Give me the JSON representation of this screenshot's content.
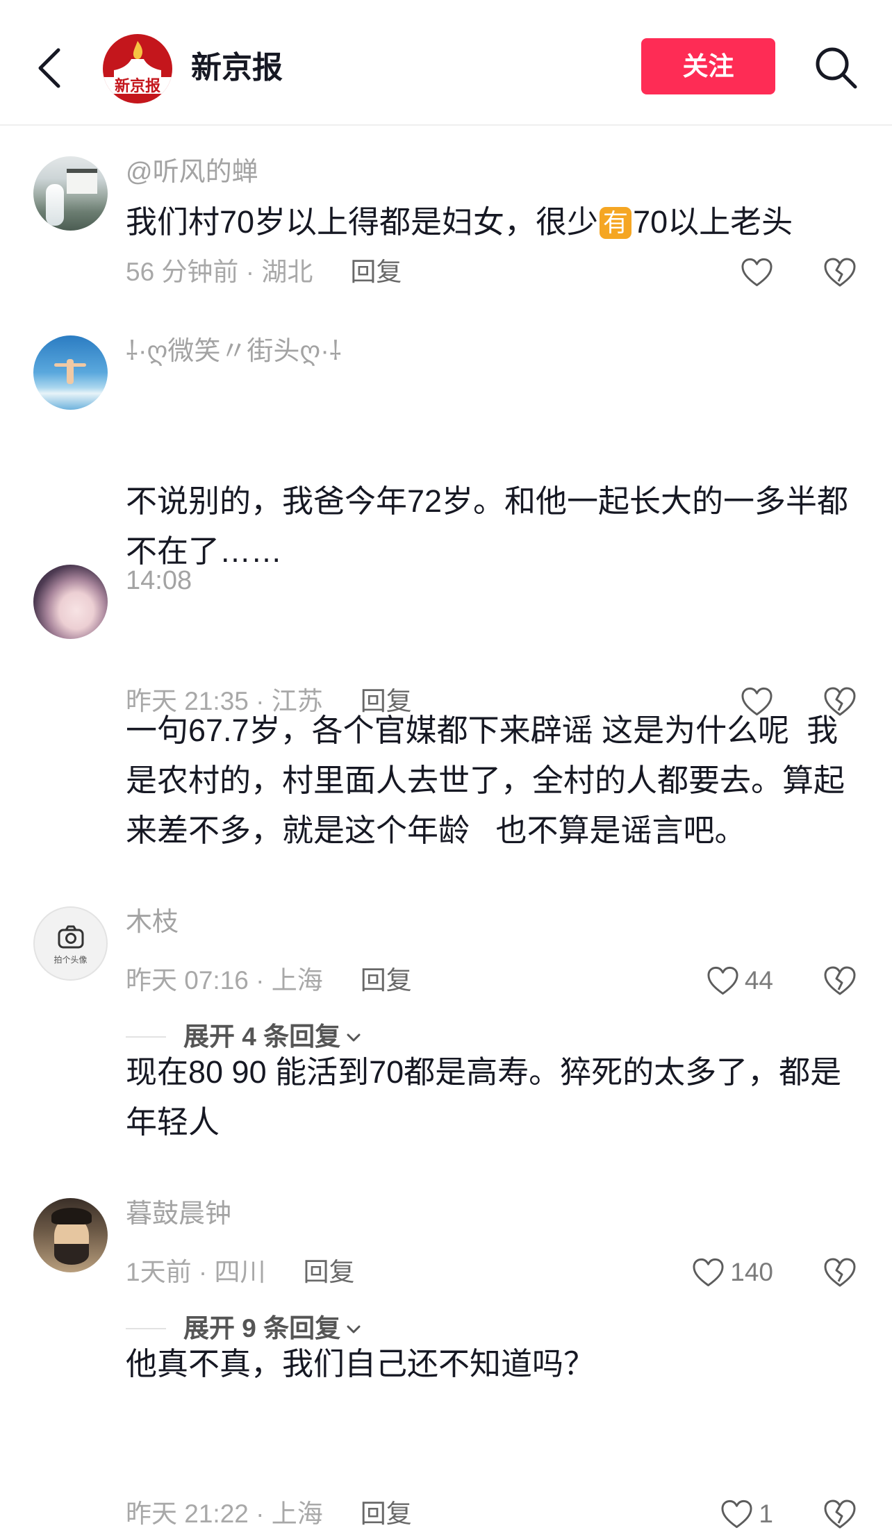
{
  "header": {
    "back_icon": "chevron-left-icon",
    "logo_text": "新京报",
    "title": "新京报",
    "follow_label": "关注",
    "search_icon": "search-icon"
  },
  "colors": {
    "accent": "#FE2C55",
    "text": "#161823",
    "muted": "#A8A8A8",
    "emoji_badge": "#F5A623"
  },
  "icons": {
    "like": "heart-outline-icon",
    "dislike": "broken-heart-icon",
    "expand": "chevron-down-icon",
    "avatar_placeholder": "camera-icon"
  },
  "comments": [
    {
      "username": "@听风的蝉",
      "text_before": "我们村70岁以上得都是妇女，很少",
      "emoji_label": "有",
      "text_after": "70以上老头",
      "time_location": "56 分钟前 · 湖北",
      "reply_label": "回复"
    },
    {
      "username": "⸸·ღ微笑〃街头ღ·⸸",
      "text_lines": [
        "不说别的，我爸今年72岁。和他一起长大的一多半都",
        "不在了……"
      ],
      "time_location": "昨天 21:35 · 江苏",
      "reply_label": "回复"
    },
    {
      "username": "14:08",
      "text_lines": [
        "一句67.7岁，各个官媒都下来辟谣 这是为什么呢  我",
        "是农村的，村里面人去世了，全村的人都要去。算起",
        "来差不多，就是这个年龄   也不算是谣言吧。"
      ],
      "time_location": "昨天 07:16 · 上海",
      "reply_label": "回复",
      "like_count": "44",
      "expand_label": "展开 4 条回复"
    },
    {
      "username": "木枝",
      "avatar_placeholder": "拍个头像",
      "text_lines": [
        "现在80 90 能活到70都是高寿。猝死的太多了，都是",
        "年轻人"
      ],
      "time_location": "1天前 · 四川",
      "reply_label": "回复",
      "like_count": "140",
      "expand_label": "展开 9 条回复"
    },
    {
      "username": "暮鼓晨钟",
      "text_lines": [
        "他真不真，我们自己还不知道吗？"
      ],
      "time_location": "昨天 21:22 · 上海",
      "reply_label": "回复",
      "like_count": "1"
    }
  ]
}
